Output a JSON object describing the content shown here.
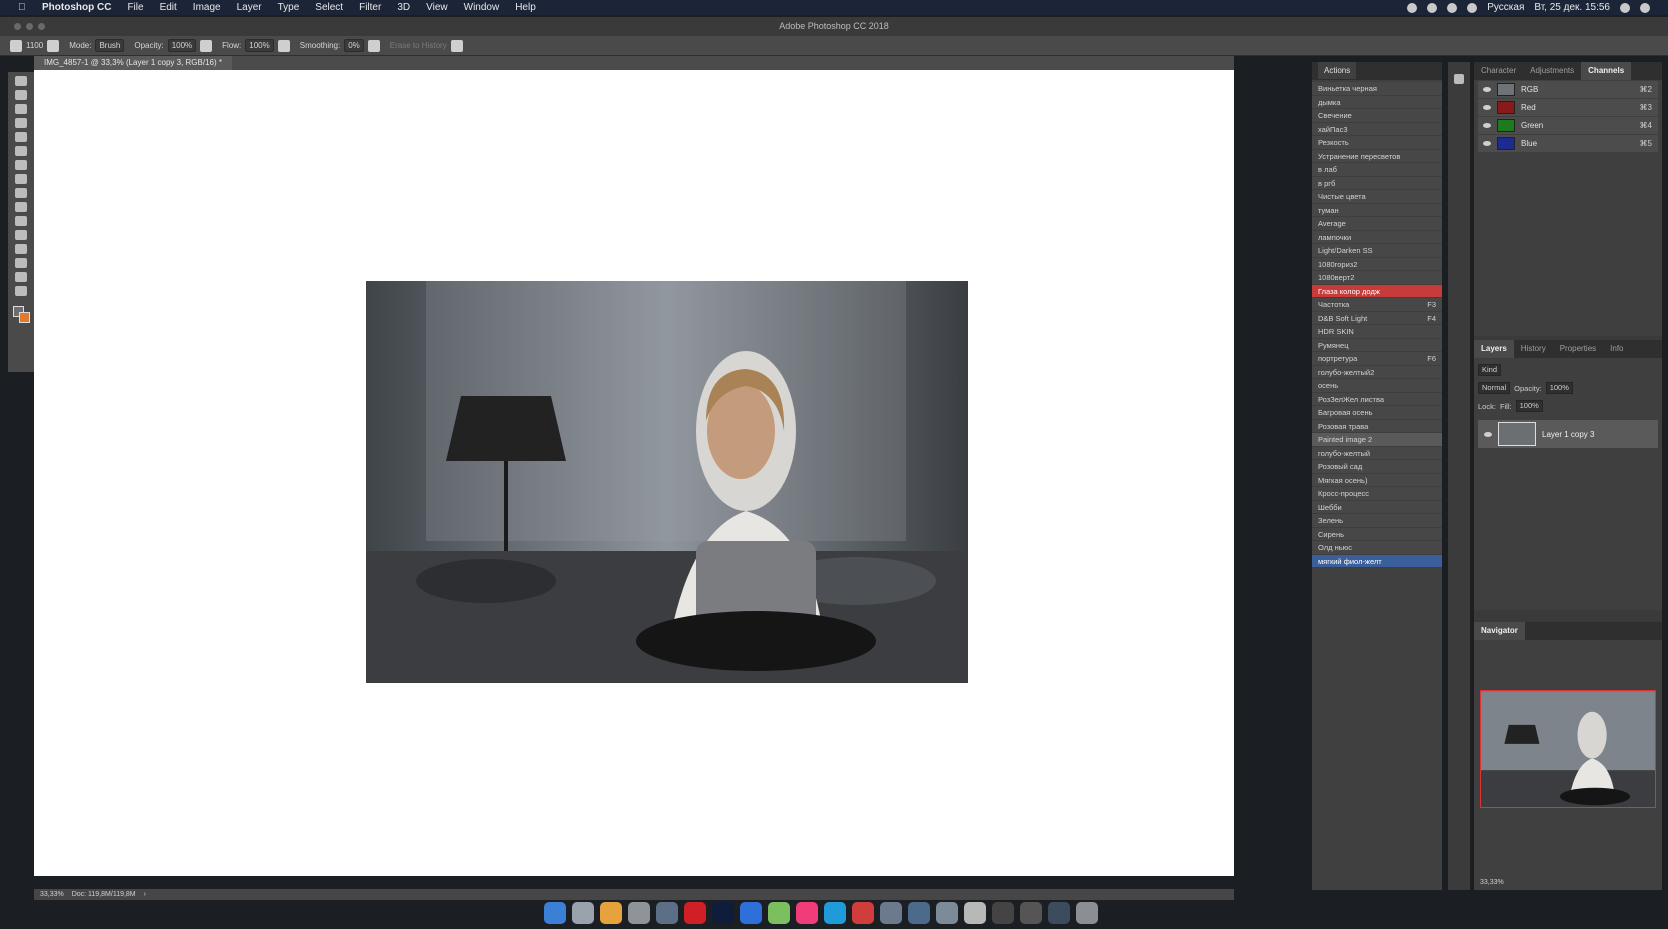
{
  "menubar": {
    "app_name": "Photoshop CC",
    "menus": [
      "File",
      "Edit",
      "Image",
      "Layer",
      "Type",
      "Select",
      "Filter",
      "3D",
      "View",
      "Window",
      "Help"
    ],
    "input_language": "Русская",
    "datetime": "Вт, 25 дек. 15:56"
  },
  "window": {
    "title": "Adobe Photoshop CC 2018"
  },
  "options_bar": {
    "brush_size": "1100",
    "mode_label": "Mode:",
    "mode_value": "Brush",
    "opacity_label": "Opacity:",
    "opacity_value": "100%",
    "flow_label": "Flow:",
    "flow_value": "100%",
    "smoothing_label": "Smoothing:",
    "smoothing_value": "0%",
    "erase_history_label": "Erase to History"
  },
  "document": {
    "tab_title": "IMG_4857-1 @ 33,3% (Layer 1 copy 3, RGB/16) *",
    "zoom": "33,33%",
    "doc_size": "Doc: 119,8M/119,8M"
  },
  "actions_panel": {
    "tab_label": "Actions",
    "items": [
      {
        "label": "Виньетка черная",
        "shortcut": ""
      },
      {
        "label": "дымка",
        "shortcut": ""
      },
      {
        "label": "Свечение",
        "shortcut": ""
      },
      {
        "label": "хайПас3",
        "shortcut": ""
      },
      {
        "label": "Резкость",
        "shortcut": ""
      },
      {
        "label": "Устранение пересветов",
        "shortcut": ""
      },
      {
        "label": "в лаб",
        "shortcut": ""
      },
      {
        "label": "в ргб",
        "shortcut": ""
      },
      {
        "label": "Чистые цвета",
        "shortcut": ""
      },
      {
        "label": "туман",
        "shortcut": ""
      },
      {
        "label": "Average",
        "shortcut": ""
      },
      {
        "label": "лампочки",
        "shortcut": ""
      },
      {
        "label": "Light/Darken SS",
        "shortcut": ""
      },
      {
        "label": "1080гориз2",
        "shortcut": ""
      },
      {
        "label": "1080верт2",
        "shortcut": ""
      },
      {
        "label": "Глаза колор додж",
        "shortcut": ""
      },
      {
        "label": "Частотка",
        "shortcut": "F3"
      },
      {
        "label": "D&B Soft Light",
        "shortcut": "F4"
      },
      {
        "label": "HDR SKIN",
        "shortcut": ""
      },
      {
        "label": "Румянец",
        "shortcut": ""
      },
      {
        "label": "портретура",
        "shortcut": "F6"
      },
      {
        "label": "голубо-желтый2",
        "shortcut": ""
      },
      {
        "label": "осень",
        "shortcut": ""
      },
      {
        "label": "РозЗелЖел листва",
        "shortcut": ""
      },
      {
        "label": "Багровая осень",
        "shortcut": ""
      },
      {
        "label": "Розовая трава",
        "shortcut": ""
      },
      {
        "label": "Painted image 2",
        "shortcut": ""
      },
      {
        "label": "голубо-желтый",
        "shortcut": ""
      },
      {
        "label": "Розовый сад",
        "shortcut": ""
      },
      {
        "label": "Мягкая осень)",
        "shortcut": ""
      },
      {
        "label": "Кросс-процесс",
        "shortcut": ""
      },
      {
        "label": "Шебби",
        "shortcut": ""
      },
      {
        "label": "Зелень",
        "shortcut": ""
      },
      {
        "label": "Сирень",
        "shortcut": ""
      },
      {
        "label": "Олд ньюс",
        "shortcut": ""
      },
      {
        "label": "мягкий фиол-желт",
        "shortcut": ""
      }
    ],
    "highlight_red_index": 15,
    "highlight_grey_index": 26,
    "selected_index": 35
  },
  "channels_panel": {
    "tabs": [
      "Character",
      "Adjustments",
      "Channels"
    ],
    "active_tab": "Channels",
    "channels": [
      {
        "name": "RGB",
        "shortcut": "⌘2",
        "thumb_color": "#6f7377"
      },
      {
        "name": "Red",
        "shortcut": "⌘3",
        "thumb_color": "#8a1a1a"
      },
      {
        "name": "Green",
        "shortcut": "⌘4",
        "thumb_color": "#1f7a1f"
      },
      {
        "name": "Blue",
        "shortcut": "⌘5",
        "thumb_color": "#1d2a8f"
      }
    ]
  },
  "layers_panel": {
    "tabs": [
      "Layers",
      "History",
      "Properties",
      "Info"
    ],
    "active_tab": "Layers",
    "filter_kind": "Kind",
    "blend_mode": "Normal",
    "opacity_label": "Opacity:",
    "opacity_value": "100%",
    "lock_label": "Lock:",
    "fill_label": "Fill:",
    "fill_value": "100%",
    "layers": [
      {
        "name": "Layer 1 copy 3"
      }
    ]
  },
  "navigator_panel": {
    "tab_label": "Navigator",
    "zoom": "33,33%"
  },
  "colors": {
    "foreground": "#6d6d6d",
    "background": "#e07a2e",
    "menubar_bg": "#1c2438",
    "accent_red": "#c73b3b",
    "accent_blue": "#3a5f9a"
  }
}
